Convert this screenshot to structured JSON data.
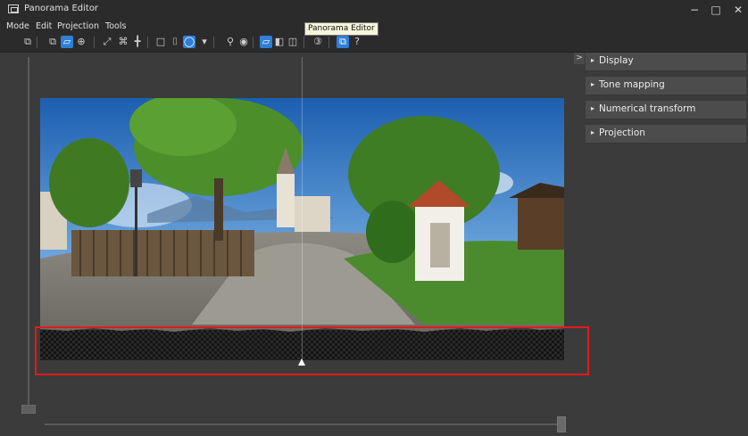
{
  "window": {
    "title": "Panorama Editor",
    "minimize": "−",
    "maximize": "□",
    "close": "✕"
  },
  "menu": [
    "Mode",
    "Edit",
    "Projection",
    "Tools"
  ],
  "tooltip": "Panorama Editor",
  "toolbar": {
    "buttons": [
      {
        "name": "mode-view-icon",
        "glyph": "⧉",
        "active": false
      },
      {
        "name": "mode-crop-icon",
        "glyph": "⧉",
        "active": false
      },
      {
        "name": "mode-edit-icon",
        "glyph": "▱",
        "active": true
      },
      {
        "name": "mode-move-icon",
        "glyph": "⊕",
        "active": false
      },
      {
        "name": "fit-icon",
        "glyph": "⤢",
        "active": false
      },
      {
        "name": "align-icon",
        "glyph": "⌘",
        "active": false
      },
      {
        "name": "center-icon",
        "glyph": "╋",
        "active": false
      },
      {
        "name": "projection-rect-icon",
        "glyph": "□",
        "active": false
      },
      {
        "name": "projection-cylinder-icon",
        "glyph": "⌷",
        "active": false
      },
      {
        "name": "projection-sphere-icon",
        "glyph": "◯",
        "active": true
      },
      {
        "name": "projection-dropdown-icon",
        "glyph": "▾",
        "active": false
      },
      {
        "name": "zoom-icon",
        "glyph": "⚲",
        "active": false
      },
      {
        "name": "eye-icon",
        "glyph": "◉",
        "active": false
      },
      {
        "name": "view-single-icon",
        "glyph": "▱",
        "active": true
      },
      {
        "name": "view-half-icon",
        "glyph": "◧",
        "active": false
      },
      {
        "name": "view-split-icon",
        "glyph": "◫",
        "active": false
      },
      {
        "name": "stereo-icon",
        "glyph": "③",
        "active": false
      },
      {
        "name": "panel-toggle-icon",
        "glyph": "⧉",
        "active": true
      },
      {
        "name": "help-icon",
        "glyph": "?",
        "active": false
      }
    ]
  },
  "panel": {
    "collapse": ">",
    "sections": [
      {
        "arrow": "▸",
        "label": "Display"
      },
      {
        "arrow": "▸",
        "label": "Tone mapping"
      },
      {
        "arrow": "▸",
        "label": "Numerical transform"
      },
      {
        "arrow": "▸",
        "label": "Projection"
      }
    ]
  },
  "colors": {
    "background": "#3b3b3b",
    "chrome": "#2b2b2b",
    "accent": "#2f7fd8",
    "highlight": "#e01b1b"
  }
}
